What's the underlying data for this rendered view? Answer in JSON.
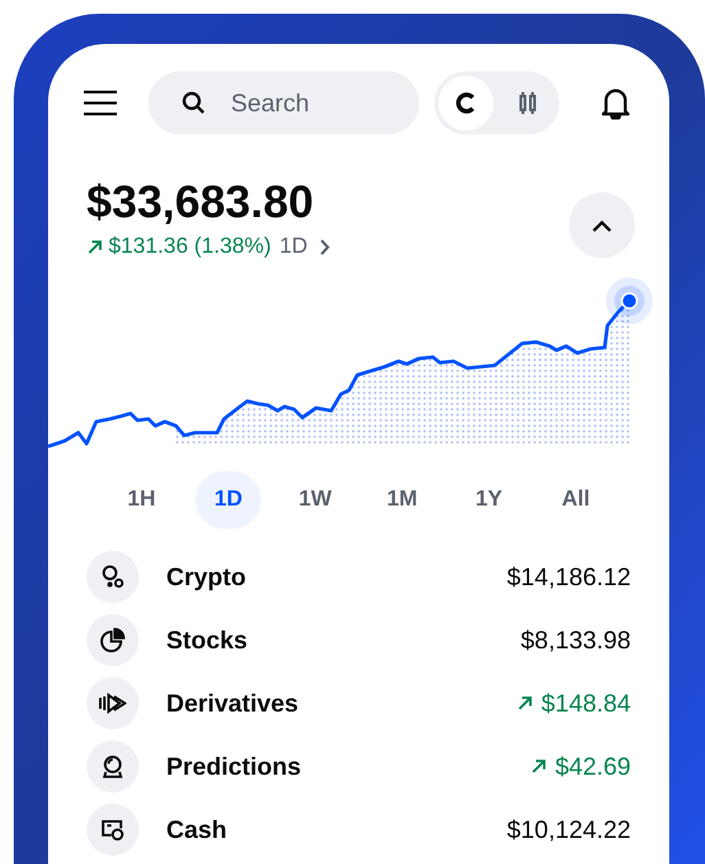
{
  "search": {
    "placeholder": "Search"
  },
  "view_toggle": [
    {
      "selected": true
    },
    {
      "selected": false
    }
  ],
  "balance": {
    "amount": "$33,683.80",
    "change": "$131.36 (1.38%)",
    "period": "1D"
  },
  "timeframes": [
    {
      "label": "1H",
      "selected": false
    },
    {
      "label": "1D",
      "selected": true
    },
    {
      "label": "1W",
      "selected": false
    },
    {
      "label": "1M",
      "selected": false
    },
    {
      "label": "1Y",
      "selected": false
    },
    {
      "label": "All",
      "selected": false
    }
  ],
  "assets": [
    {
      "name": "Crypto",
      "value": "$14,186.12",
      "kind": "plain"
    },
    {
      "name": "Stocks",
      "value": "$8,133.98",
      "kind": "plain"
    },
    {
      "name": "Derivatives",
      "value": "$148.84",
      "kind": "gain"
    },
    {
      "name": "Predictions",
      "value": "$42.69",
      "kind": "gain"
    },
    {
      "name": "Cash",
      "value": "$10,124.22",
      "kind": "plain"
    }
  ]
}
